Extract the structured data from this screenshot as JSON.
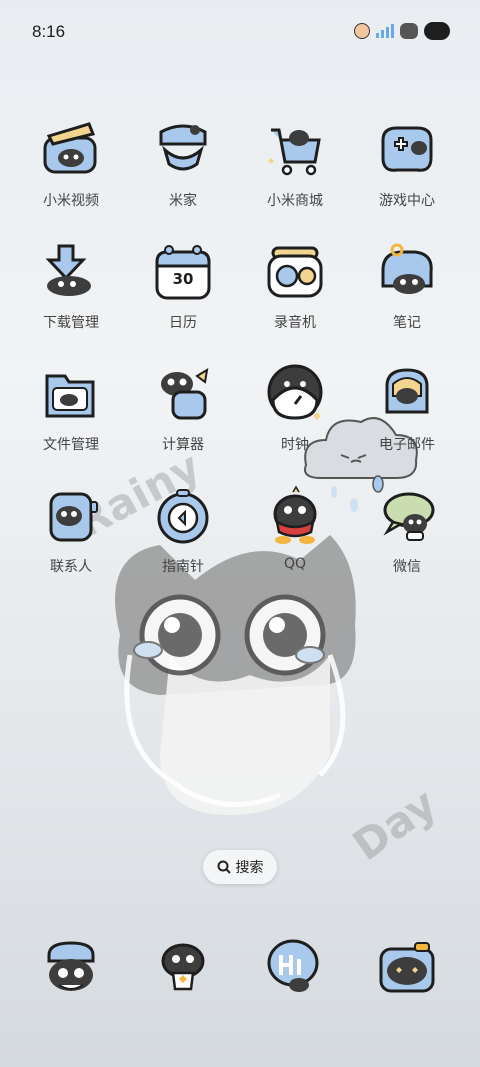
{
  "status_bar": {
    "time": "8:16"
  },
  "apps": [
    {
      "label": "小米视频",
      "icon": "video-icon"
    },
    {
      "label": "米家",
      "icon": "home-icon"
    },
    {
      "label": "小米商城",
      "icon": "shop-cart-icon"
    },
    {
      "label": "游戏中心",
      "icon": "gamepad-icon"
    },
    {
      "label": "下载管理",
      "icon": "download-icon"
    },
    {
      "label": "日历",
      "icon": "calendar-icon",
      "badge": "30"
    },
    {
      "label": "录音机",
      "icon": "recorder-icon"
    },
    {
      "label": "笔记",
      "icon": "notes-icon"
    },
    {
      "label": "文件管理",
      "icon": "folder-icon"
    },
    {
      "label": "计算器",
      "icon": "calculator-icon"
    },
    {
      "label": "时钟",
      "icon": "clock-icon"
    },
    {
      "label": "电子邮件",
      "icon": "mail-icon"
    },
    {
      "label": "联系人",
      "icon": "contacts-icon"
    },
    {
      "label": "指南针",
      "icon": "compass-icon"
    },
    {
      "label": "QQ",
      "icon": "qq-icon"
    },
    {
      "label": "微信",
      "icon": "wechat-icon"
    }
  ],
  "wallpaper": {
    "text_left": "Rainy",
    "text_right": "Day"
  },
  "search": {
    "label": "搜索"
  },
  "dock": [
    {
      "icon": "phone-icon"
    },
    {
      "icon": "messages-icon"
    },
    {
      "icon": "browser-icon"
    },
    {
      "icon": "camera-icon"
    }
  ],
  "colors": {
    "accent_blue": "#a9c9ec",
    "outline": "#1e1e1e",
    "cat_gray": "#6a6a6a"
  }
}
